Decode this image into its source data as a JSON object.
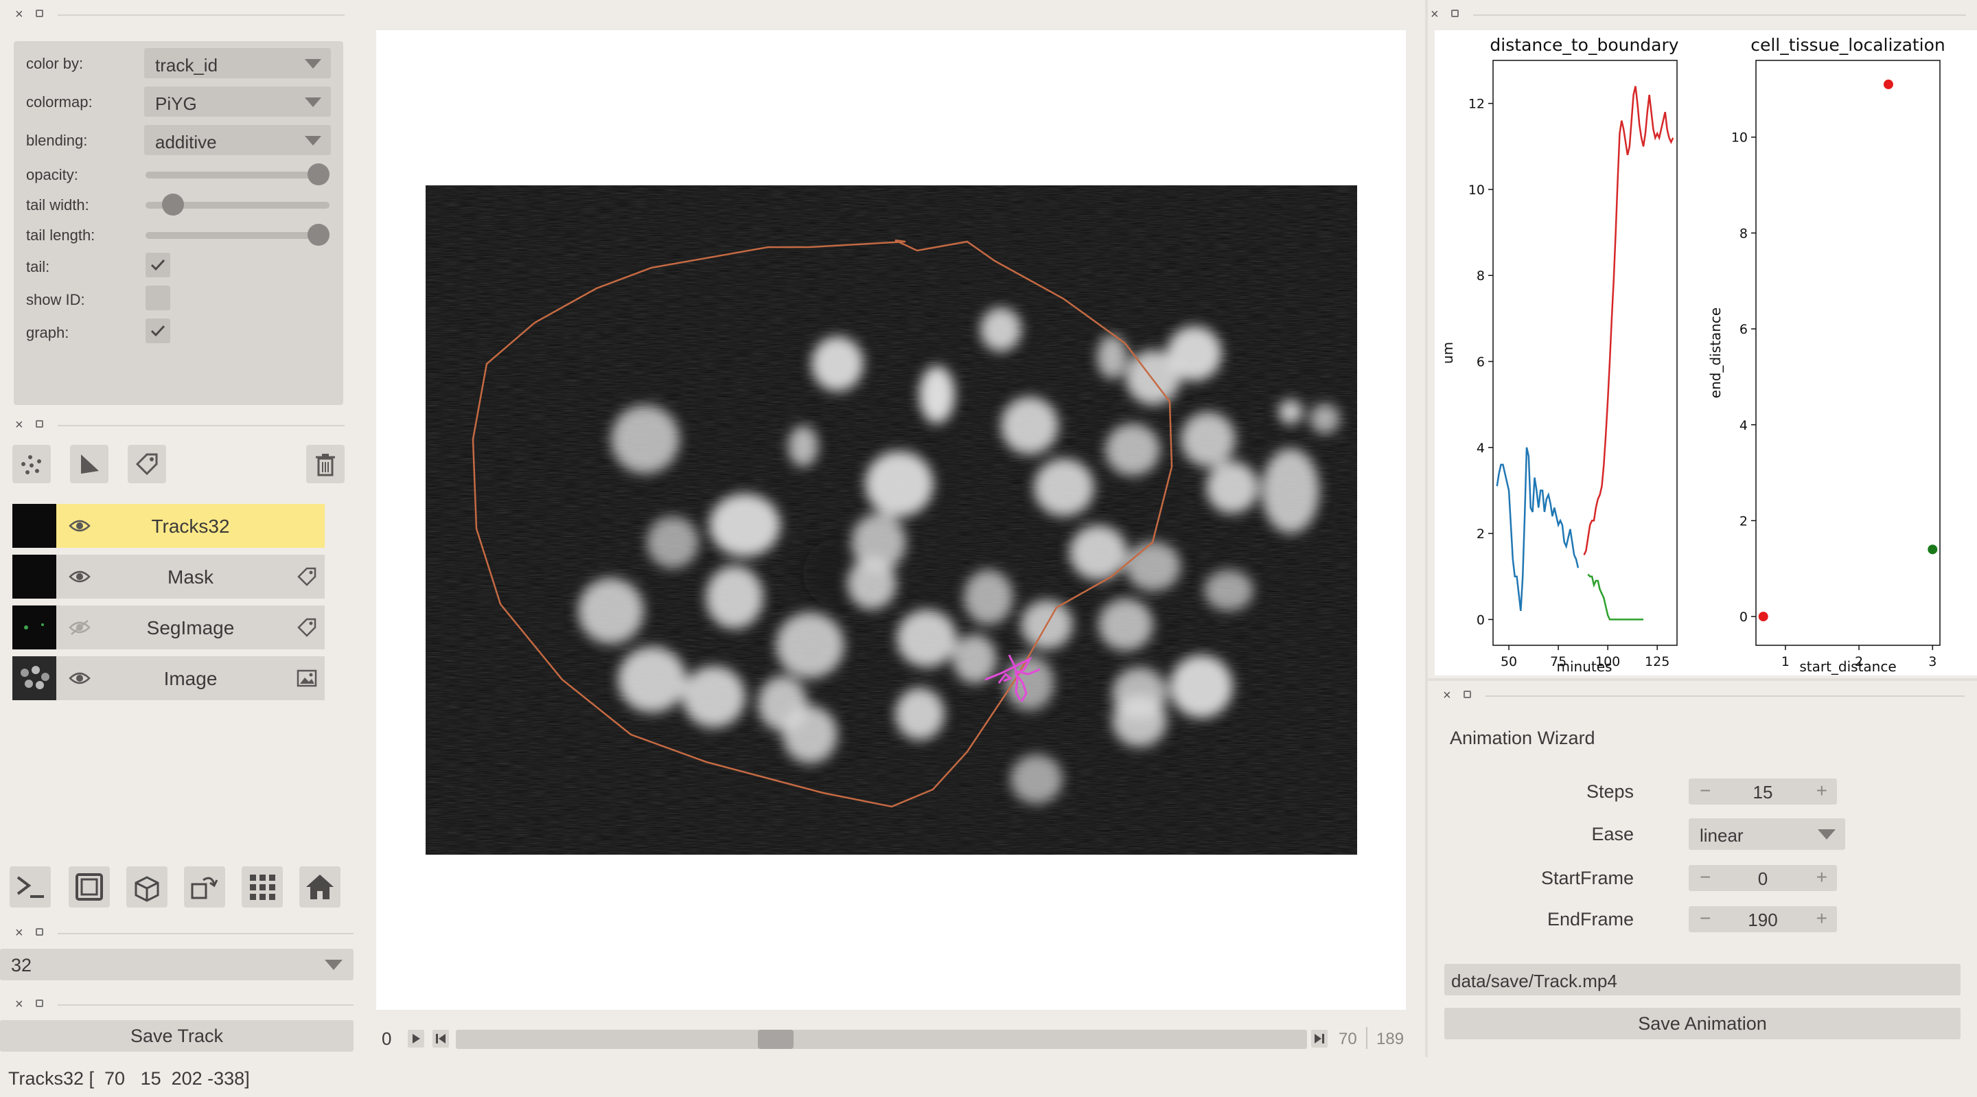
{
  "layer_controls": {
    "color_by_label": "color by:",
    "color_by_value": "track_id",
    "colormap_label": "colormap:",
    "colormap_value": "PiYG",
    "blending_label": "blending:",
    "blending_value": "additive",
    "opacity_label": "opacity:",
    "opacity_value": 1.0,
    "tail_width_label": "tail width:",
    "tail_width_value": 0.1,
    "tail_length_label": "tail length:",
    "tail_length_value": 1.0,
    "tail_label": "tail:",
    "tail_checked": true,
    "show_id_label": "show ID:",
    "show_id_checked": false,
    "graph_label": "graph:",
    "graph_checked": true
  },
  "layer_buttons": [
    "points-icon",
    "shapes-icon",
    "labels-icon",
    "delete-icon"
  ],
  "layers": [
    {
      "name": "Tracks32",
      "visible": true,
      "selected": true,
      "type_icon": ""
    },
    {
      "name": "Mask",
      "visible": true,
      "selected": false,
      "type_icon": "label-tag-icon"
    },
    {
      "name": "SegImage",
      "visible": false,
      "selected": false,
      "type_icon": "label-tag-icon"
    },
    {
      "name": "Image",
      "visible": true,
      "selected": false,
      "type_icon": "image-icon"
    }
  ],
  "bottom_buttons": [
    "console-icon",
    "2d-3d-toggle-icon",
    "roll-dims-icon",
    "transpose-icon",
    "grid-icon",
    "home-icon"
  ],
  "track_select": {
    "value": "32"
  },
  "save_track": {
    "label": "Save Track"
  },
  "status": {
    "text": "Tracks32 [  70   15  202 -338]"
  },
  "dims_slider": {
    "axis_label": "0",
    "current": "70",
    "max": "189",
    "fraction": 0.37
  },
  "chart_data": [
    {
      "type": "line",
      "title": "distance_to_boundary",
      "xlabel": "minutes",
      "ylabel": "um",
      "xlim": [
        42,
        135
      ],
      "ylim": [
        -0.6,
        13.0
      ],
      "xticks": [
        "50",
        "75",
        "100",
        "125"
      ],
      "yticks": [
        "0",
        "2",
        "4",
        "6",
        "8",
        "10",
        "12"
      ],
      "grid": false,
      "series": [
        {
          "color": "#1f77b4",
          "x": [
            44,
            45,
            46,
            47,
            48,
            49,
            50,
            51,
            52,
            53,
            54,
            55,
            56,
            57,
            58,
            59,
            60,
            61,
            62,
            63,
            64,
            65,
            66,
            67,
            68,
            69,
            70,
            71,
            72,
            73,
            74,
            75,
            76,
            77,
            78,
            79,
            80,
            81,
            82,
            83,
            84,
            85
          ],
          "y": [
            3.1,
            3.4,
            3.6,
            3.6,
            3.4,
            3.2,
            3.0,
            2.2,
            1.4,
            1.0,
            1.0,
            0.6,
            0.2,
            1.0,
            2.4,
            4.0,
            3.8,
            2.6,
            2.5,
            3.3,
            3.0,
            2.6,
            3.0,
            3.0,
            2.5,
            2.8,
            2.9,
            2.7,
            2.4,
            2.6,
            2.4,
            2.2,
            2.3,
            2.2,
            1.8,
            1.7,
            1.9,
            2.1,
            1.8,
            1.5,
            1.4,
            1.2
          ]
        },
        {
          "color": "#2ca02c",
          "x": [
            90,
            91,
            92,
            93,
            94,
            95,
            96,
            97,
            98,
            99,
            100,
            101,
            102,
            103,
            104,
            105,
            110,
            115,
            118
          ],
          "y": [
            1.05,
            1.0,
            1.0,
            0.8,
            0.9,
            0.9,
            0.7,
            0.6,
            0.5,
            0.3,
            0.1,
            0.0,
            0.0,
            0.0,
            0.0,
            0.0,
            0.0,
            0.0,
            0.0
          ]
        },
        {
          "color": "#d62728",
          "x": [
            88,
            89,
            90,
            91,
            92,
            93,
            94,
            95,
            96,
            97,
            98,
            99,
            100,
            101,
            102,
            103,
            104,
            105,
            106,
            107,
            108,
            109,
            110,
            111,
            112,
            113,
            114,
            115,
            116,
            117,
            118,
            119,
            120,
            121,
            122,
            123,
            124,
            125,
            126,
            127,
            128,
            129,
            130,
            131,
            132,
            133
          ],
          "y": [
            1.5,
            1.6,
            1.9,
            2.2,
            2.3,
            2.3,
            2.6,
            2.8,
            2.9,
            3.1,
            3.6,
            4.3,
            5.1,
            6.0,
            7.0,
            7.9,
            9.0,
            10.2,
            11.3,
            11.6,
            11.4,
            11.1,
            10.8,
            11.0,
            11.6,
            12.2,
            12.4,
            12.0,
            11.5,
            11.2,
            11.0,
            11.3,
            11.8,
            12.2,
            11.8,
            11.4,
            11.2,
            11.3,
            11.2,
            11.4,
            11.6,
            11.8,
            11.4,
            11.2,
            11.1,
            11.2
          ]
        }
      ]
    },
    {
      "type": "scatter",
      "title": "cell_tissue_localization",
      "xlabel": "start_distance",
      "ylabel": "end_distance",
      "xlim": [
        0.6,
        3.1
      ],
      "ylim": [
        -0.6,
        11.6
      ],
      "xticks": [
        "1",
        "2",
        "3"
      ],
      "yticks": [
        "0",
        "2",
        "4",
        "6",
        "8",
        "10"
      ],
      "grid": false,
      "points": [
        {
          "x": 0.7,
          "y": 0.0,
          "color": "#e41a1c"
        },
        {
          "x": 2.4,
          "y": 11.1,
          "color": "#e41a1c"
        },
        {
          "x": 3.0,
          "y": 1.4,
          "color": "#1a7a1a"
        }
      ]
    }
  ],
  "animation": {
    "title": "Animation Wizard",
    "steps_label": "Steps",
    "steps_value": "15",
    "ease_label": "Ease",
    "ease_value": "linear",
    "start_label": "StartFrame",
    "start_value": "0",
    "end_label": "EndFrame",
    "end_value": "190",
    "path": "data/save/Track.mp4",
    "save_label": "Save Animation"
  }
}
